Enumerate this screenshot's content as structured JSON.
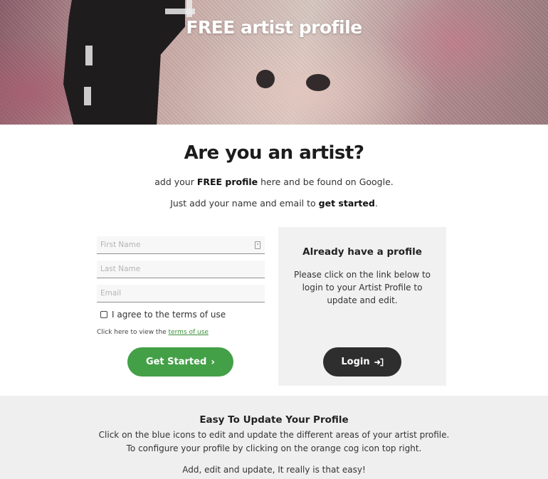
{
  "hero": {
    "title": "FREE artist profile"
  },
  "intro": {
    "heading": "Are you an artist?",
    "line1_pre": "add your ",
    "line1_bold": "FREE profile",
    "line1_post": " here and be found on Google.",
    "line2_pre": "Just add your name and email to ",
    "line2_bold": "get started",
    "line2_post": "."
  },
  "form": {
    "first_name_placeholder": "First Name",
    "last_name_placeholder": "Last Name",
    "email_placeholder": "Email",
    "agree_label": "I agree to the terms of use",
    "terms_pre": "Click here to view the ",
    "terms_link": "terms of use",
    "submit_label": "Get Started"
  },
  "login_panel": {
    "title": "Already have a profile",
    "text": "Please click on the link below to login to your Artist Profile to update and edit.",
    "button_label": "Login"
  },
  "footer": {
    "heading": "Easy To Update Your Profile",
    "line1": "Click on the blue icons to edit and update the different areas of your artist profile.",
    "line2": "To configure your profile by clicking on the orange cog icon top right.",
    "line3": "Add, edit and update, It really is that easy!"
  },
  "colors": {
    "primary_green": "#43a047",
    "dark_button": "#2e2e2e",
    "panel_bg": "#f1f1f1"
  }
}
